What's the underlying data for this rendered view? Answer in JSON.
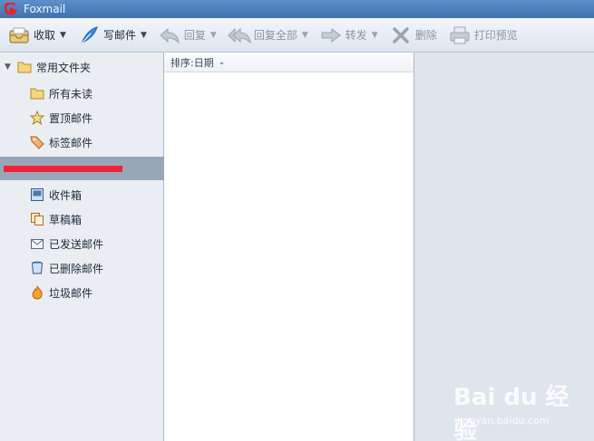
{
  "app": {
    "title": "Foxmail"
  },
  "toolbar": {
    "receive": "收取",
    "compose": "写邮件",
    "reply": "回复",
    "reply_all": "回复全部",
    "forward": "转发",
    "delete": "删除",
    "print_preview": "打印预览"
  },
  "sidebar": {
    "group_common": "常用文件夹",
    "common": [
      {
        "label": "所有未读",
        "icon": "folder-icon"
      },
      {
        "label": "置顶邮件",
        "icon": "star-icon"
      },
      {
        "label": "标签邮件",
        "icon": "tag-icon"
      }
    ],
    "account": [
      {
        "label": "收件箱",
        "icon": "inbox-icon"
      },
      {
        "label": "草稿箱",
        "icon": "drafts-icon"
      },
      {
        "label": "已发送邮件",
        "icon": "sent-icon"
      },
      {
        "label": "已删除邮件",
        "icon": "trash-icon"
      },
      {
        "label": "垃圾邮件",
        "icon": "junk-icon"
      }
    ]
  },
  "message_list": {
    "sort_label": "排序:日期"
  },
  "watermark": {
    "brand": "Bai du 经验",
    "url": "jingyan.baidu.com"
  }
}
